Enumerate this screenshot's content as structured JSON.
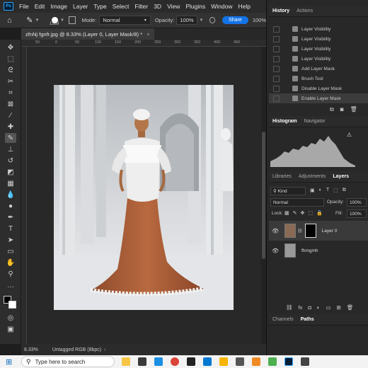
{
  "menubar": {
    "app_badge": "Ps",
    "items": [
      "File",
      "Edit",
      "Image",
      "Layer",
      "Type",
      "Select",
      "Filter",
      "3D",
      "View",
      "Plugins",
      "Window",
      "Help"
    ]
  },
  "options": {
    "brush_size": "1539",
    "mode_label": "Mode:",
    "mode_value": "Normal",
    "opacity_label": "Opacity:",
    "opacity_value": "100%",
    "share_label": "Share",
    "flow_value": "100%"
  },
  "document": {
    "tab_title": "zfnNj fgnfr.jpg @ 8.33% (Layer 0, Layer Mask/8) *",
    "ruler_marks": [
      "50",
      "0",
      "50",
      "100",
      "150",
      "200",
      "250",
      "300",
      "350",
      "400",
      "450"
    ],
    "zoom": "8.33%",
    "color_info": "Untagged RGB (8bpc)"
  },
  "history": {
    "tabs": [
      "History",
      "Actions"
    ],
    "items": [
      "Layer Visibility",
      "Layer Visibility",
      "Layer Visibility",
      "Layer Visibility",
      "Add Layer Mask",
      "Brush Tool",
      "Disable Layer Mask",
      "Enable Layer Mask"
    ]
  },
  "histogram": {
    "tabs": [
      "Histogram",
      "Navigator"
    ]
  },
  "layers": {
    "tabs": [
      "Libraries",
      "Adjustments",
      "Layers"
    ],
    "kind_label": "Kind",
    "blend_mode": "Normal",
    "opacity_label": "Opacity:",
    "opacity_value": "100%",
    "lock_label": "Lock:",
    "fill_label": "Fill:",
    "fill_value": "100%",
    "rows": [
      {
        "name": "Layer 0"
      },
      {
        "name": "fhmgmh"
      }
    ]
  },
  "bottom_tabs": [
    "Channels",
    "Paths"
  ],
  "taskbar": {
    "search_placeholder": "Type here to search"
  }
}
